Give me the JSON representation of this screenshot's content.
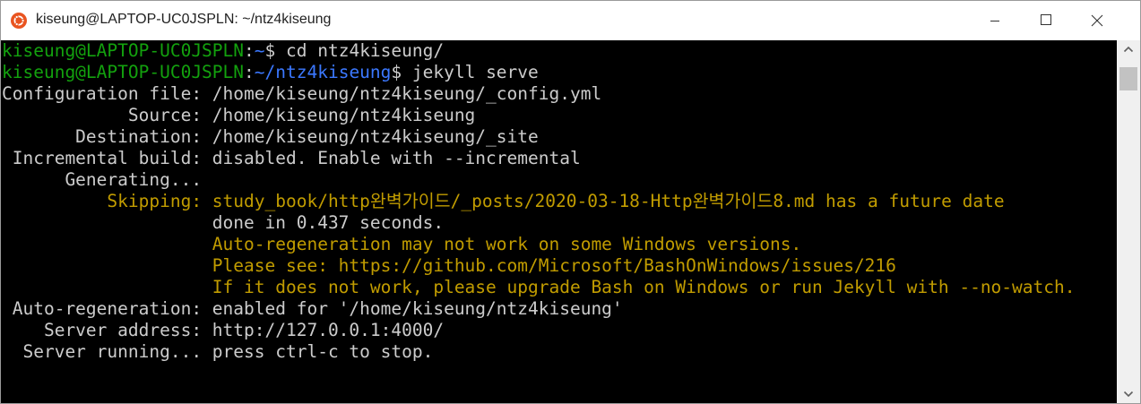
{
  "window": {
    "title": "kiseung@LAPTOP-UC0JSPLN: ~/ntz4kiseung",
    "app_icon": "ubuntu-icon",
    "controls": {
      "minimize": "minimize-icon",
      "maximize": "maximize-icon",
      "close": "close-icon"
    }
  },
  "colors": {
    "background": "#000000",
    "prompt_user": "#13a10e",
    "prompt_path": "#3b78ff",
    "text": "#cccccc",
    "warning": "#c19c00"
  },
  "terminal": {
    "lines": [
      {
        "user": "kiseung@LAPTOP-UC0JSPLN",
        "sep": ":",
        "path": "~",
        "cmd": "$ cd ntz4kiseung/"
      },
      {
        "user": "kiseung@LAPTOP-UC0JSPLN",
        "sep": ":",
        "path": "~/ntz4kiseung",
        "cmd": "$ jekyll serve"
      },
      {
        "label": "Configuration file:",
        "value": " /home/kiseung/ntz4kiseung/_config.yml"
      },
      {
        "label": "            Source:",
        "value": " /home/kiseung/ntz4kiseung"
      },
      {
        "label": "       Destination:",
        "value": " /home/kiseung/ntz4kiseung/_site"
      },
      {
        "label": " Incremental build:",
        "value": " disabled. Enable with --incremental"
      },
      {
        "label": "      Generating...",
        "value": ""
      },
      {
        "label": "          Skipping:",
        "value": " study_book/http완벽가이드/_posts/2020-03-18-Http완벽가이드8.md has a future date"
      },
      {
        "label": "                   ",
        "value": " done in 0.437 seconds."
      },
      {
        "label": "                   ",
        "value": " Auto-regeneration may not work on some Windows versions."
      },
      {
        "label": "                   ",
        "value": " Please see: https://github.com/Microsoft/BashOnWindows/issues/216"
      },
      {
        "label": "                   ",
        "value": " If it does not work, please upgrade Bash on Windows or run Jekyll with --no-watch."
      },
      {
        "label": " Auto-regeneration:",
        "value": " enabled for '/home/kiseung/ntz4kiseung'"
      },
      {
        "label": "    Server address:",
        "value": " http://127.0.0.1:4000/"
      },
      {
        "label": "  Server running...",
        "value": " press ctrl-c to stop."
      }
    ]
  }
}
